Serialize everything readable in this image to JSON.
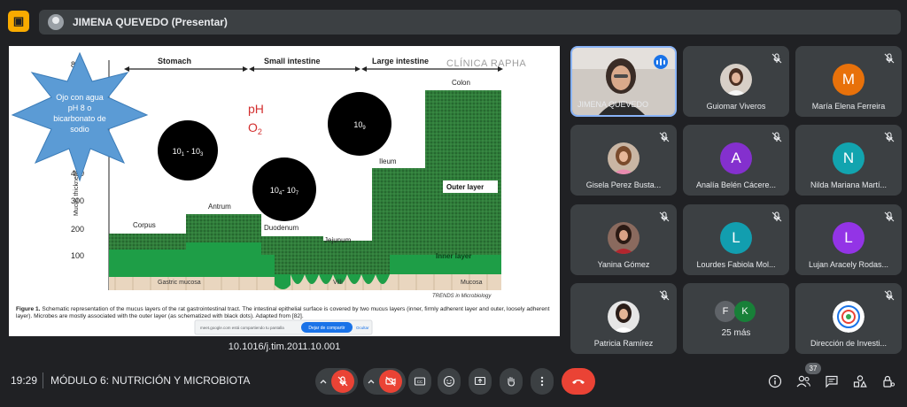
{
  "header": {
    "presenter_label": "JIMENA QUEVEDO (Presentar)"
  },
  "slide": {
    "watermark": "CLÍNICA RAPHA",
    "section_stomach": "Stomach",
    "section_small": "Small intestine",
    "section_large": "Large intestine",
    "y_axis_label": "Mucus thickness",
    "ticks": [
      "800",
      "400",
      "300",
      "200",
      "100"
    ],
    "starburst_text": [
      "Ojo con agua",
      "pH 8 o",
      "bicarbonato de",
      "sodio"
    ],
    "ph_label": "pH",
    "o2_label": "O",
    "o2_sub": "2",
    "circle1": {
      "base1": "10",
      "sub1": "1",
      "sep": " - ",
      "base2": "10",
      "sub2": "3"
    },
    "circle2": {
      "base1": "10",
      "sub1": "4",
      "sep": "- ",
      "base2": "10",
      "sub2": "7"
    },
    "circle3": {
      "base": "10",
      "sub": "9"
    },
    "regions": [
      "Corpus",
      "Antrum",
      "Duodenum",
      "Jejunum",
      "Ileum",
      "Colon"
    ],
    "outer_layer": "Outer layer",
    "inner_layer": "Inner layer",
    "gastric_mucosa": "Gastric mucosa",
    "villi": "Villi",
    "mucosa": "Mucosa",
    "journal": "TRENDS in Microbiology",
    "caption_bold": "Figure 1.",
    "caption_text": "Schematic representation of the mucus layers of the rat gastrointestinal tract. The intestinal epithelial surface is covered by two mucus layers (inner, firmly adherent layer and outer, loosely adherent layer). Microbes are mostly associated with the outer layer (as schematized with black dots). Adapted from [82].",
    "share_notice": "meet.google.com está compartiendo tu pantalla",
    "share_stop": "Dejar de compartir",
    "share_hide": "Ocultar",
    "doi": "10.1016/j.tim.2011.10.001"
  },
  "participants": [
    {
      "name": "JIMENA QUEVEDO",
      "type": "video"
    },
    {
      "name": "Guiomar Viveros",
      "type": "photo"
    },
    {
      "name": "María Elena Ferreira",
      "type": "letter",
      "letter": "M",
      "color": "#e8710a"
    },
    {
      "name": "Gisela Perez Busta...",
      "type": "photo"
    },
    {
      "name": "Analía Belén Cácere...",
      "type": "letter",
      "letter": "A",
      "color": "#8430ce"
    },
    {
      "name": "Nilda Mariana Martí...",
      "type": "letter",
      "letter": "N",
      "color": "#12a4af"
    },
    {
      "name": "Yanina Gómez",
      "type": "photo"
    },
    {
      "name": "Lourdes Fabiola Mol...",
      "type": "letter",
      "letter": "L",
      "color": "#129eaf"
    },
    {
      "name": "Lujan Aracely Rodas...",
      "type": "letter",
      "letter": "L",
      "color": "#9334e6"
    },
    {
      "name": "Patricia Ramírez",
      "type": "photo"
    },
    {
      "name": "25 más",
      "type": "more",
      "letters": [
        "F",
        "K"
      ]
    },
    {
      "name": "Dirección de Investi...",
      "type": "logo"
    }
  ],
  "footer": {
    "time": "19:29",
    "meeting_title": "MÓDULO 6: NUTRICIÓN Y MICROBIOTA",
    "participant_count": "37"
  },
  "colors": {
    "accent_red": "#ea4335",
    "accent_blue": "#1a73e8",
    "mucus_green": "#1e8e3e",
    "mucus_outer": "#3b7d3f"
  }
}
